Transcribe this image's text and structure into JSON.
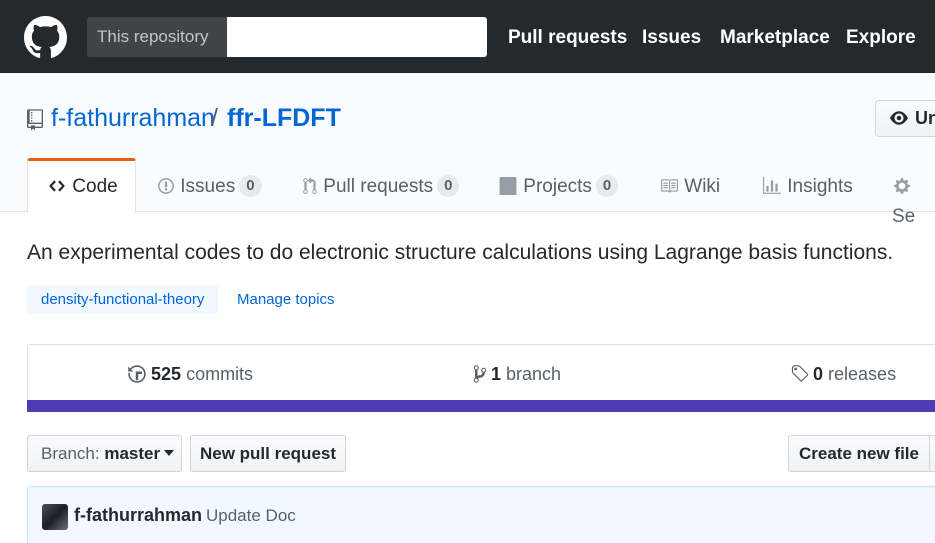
{
  "header": {
    "scope_label": "This repository",
    "search_value": "",
    "nav": [
      "Pull requests",
      "Issues",
      "Marketplace",
      "Explore"
    ]
  },
  "repo": {
    "owner": "f-fathurrahman",
    "separator": "/",
    "name": "ffr-LFDFT",
    "watch_label": "Un"
  },
  "tabs": [
    {
      "label": "Code",
      "icon": "code-icon",
      "selected": true
    },
    {
      "label": "Issues",
      "count": "0",
      "icon": "issue-icon"
    },
    {
      "label": "Pull requests",
      "count": "0",
      "icon": "pull-request-icon"
    },
    {
      "label": "Projects",
      "count": "0",
      "icon": "project-icon"
    },
    {
      "label": "Wiki",
      "icon": "book-icon"
    },
    {
      "label": "Insights",
      "icon": "graph-icon"
    },
    {
      "label": "Se",
      "icon": "gear-icon"
    }
  ],
  "description": "An experimental codes to do electronic structure calculations using Lagrange basis functions.",
  "topics": [
    "density-functional-theory"
  ],
  "manage_topics": "Manage topics",
  "summary": {
    "commits_count": "525",
    "commits_label": "commits",
    "branch_count": "1",
    "branch_label": "branch",
    "releases_count": "0",
    "releases_label": "releases"
  },
  "language_bar_color": "#4f3cb5",
  "file_nav": {
    "branch_prefix": "Branch:",
    "branch_name": "master",
    "new_pull_request": "New pull request",
    "create_new_file": "Create new file"
  },
  "commit": {
    "author": "f-fathurrahman",
    "message": "Update Doc"
  },
  "colors": {
    "header_bg": "#24292e",
    "link": "#0366d6",
    "tab_accent": "#e36209"
  }
}
